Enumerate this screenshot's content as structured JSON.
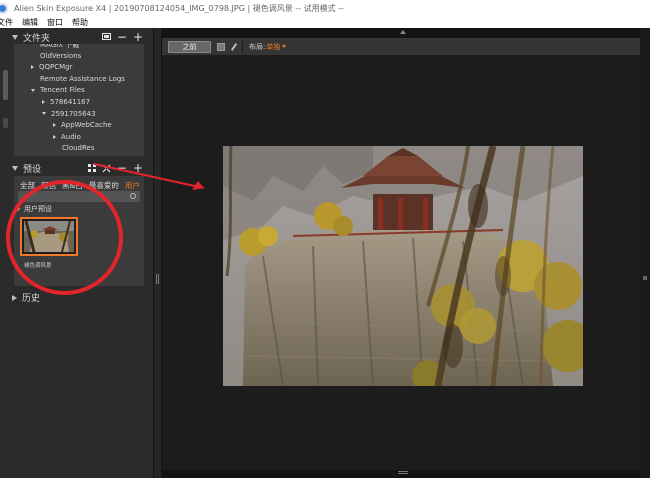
{
  "window": {
    "title": "Alien Skin Exposure X4 | 20190708124054_IMG_0798.JPG | 褪色调风景 -- 试用模式 --"
  },
  "menu": {
    "items": [
      "文件",
      "编辑",
      "窗口",
      "帮助"
    ]
  },
  "folders": {
    "title": "文件夹",
    "items": [
      {
        "label": "MAGIX 下载",
        "indent": 0,
        "expander": "none"
      },
      {
        "label": "OldVersions",
        "indent": 0,
        "expander": "none"
      },
      {
        "label": "QQPCMgr",
        "indent": 0,
        "expander": "collapsed"
      },
      {
        "label": "Remote Assistance Logs",
        "indent": 0,
        "expander": "none"
      },
      {
        "label": "Tencent Files",
        "indent": 0,
        "expander": "expanded"
      },
      {
        "label": "578641167",
        "indent": 1,
        "expander": "collapsed"
      },
      {
        "label": "2591705643",
        "indent": 1,
        "expander": "expanded"
      },
      {
        "label": "AppWebCache",
        "indent": 2,
        "expander": "collapsed"
      },
      {
        "label": "Audio",
        "indent": 2,
        "expander": "collapsed"
      },
      {
        "label": "CloudRes",
        "indent": 2,
        "expander": "none"
      }
    ]
  },
  "presets": {
    "title": "预设",
    "tabs": [
      "全部",
      "颜色",
      "黑&白",
      "最喜爱的",
      "用户"
    ],
    "active_tab": "用户",
    "subgroup": "用户预设",
    "thumbnail_caption": "褪色调风景"
  },
  "history": {
    "title": "历史"
  },
  "toolbar": {
    "before_label": "之前",
    "layout_label": "布局:",
    "layout_value": "单独"
  },
  "colors": {
    "accent": "#f07828",
    "annotation": "#e2252b"
  },
  "icons": {
    "folder_head": [
      "image-icon",
      "minus-icon",
      "plus-icon"
    ],
    "preset_head": [
      "grid-icon",
      "collapse-icon",
      "minus-icon",
      "plus-icon"
    ]
  }
}
